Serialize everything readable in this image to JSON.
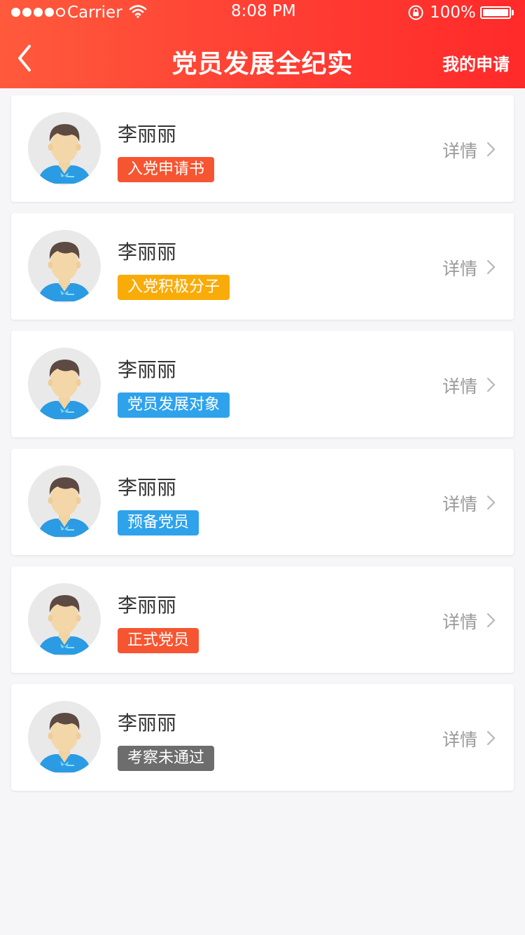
{
  "status_bar": {
    "carrier": "Carrier",
    "time": "8:08 PM",
    "battery": "100%"
  },
  "nav": {
    "title": "党员发展全纪实",
    "right_action": "我的申请"
  },
  "detail_label": "详情",
  "colors": {
    "header_start": "#ff5a3c",
    "header_end": "#ff2a2a",
    "tag_red": "#f65531",
    "tag_yellow": "#f9ab08",
    "tag_blue": "#2fa2ec",
    "tag_gray": "#6d6d6d"
  },
  "list": [
    {
      "name": "李丽丽",
      "tag": "入党申请书",
      "tag_color": "#f65531"
    },
    {
      "name": "李丽丽",
      "tag": "入党积极分子",
      "tag_color": "#f9ab08"
    },
    {
      "name": "李丽丽",
      "tag": "党员发展对象",
      "tag_color": "#2fa2ec"
    },
    {
      "name": "李丽丽",
      "tag": "预备党员",
      "tag_color": "#2fa2ec"
    },
    {
      "name": "李丽丽",
      "tag": "正式党员",
      "tag_color": "#f65531"
    },
    {
      "name": "李丽丽",
      "tag": "考察未通过",
      "tag_color": "#6d6d6d"
    }
  ],
  "icons": [
    "back-arrow-icon",
    "wifi-icon",
    "rotation-lock-icon",
    "battery-icon",
    "avatar-icon",
    "chevron-right-icon"
  ]
}
